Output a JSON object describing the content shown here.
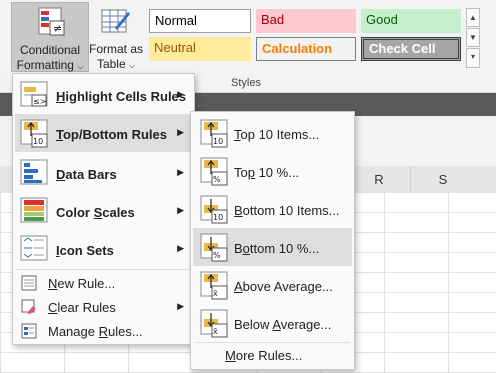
{
  "ribbon": {
    "cond_fmt_line1": "Conditional",
    "cond_fmt_line2": "Formatting",
    "format_table_line1": "Format as",
    "format_table_line2": "Table",
    "group_label": "Styles",
    "styles": [
      {
        "label": "Normal",
        "bg": "#ffffff",
        "fg": "#000000"
      },
      {
        "label": "Bad",
        "bg": "#ffc7ce",
        "fg": "#9c0006"
      },
      {
        "label": "Good",
        "bg": "#c6efce",
        "fg": "#006100"
      },
      {
        "label": "Neutral",
        "bg": "#ffeb9c",
        "fg": "#9c5700"
      },
      {
        "label": "Calculation",
        "bg": "#f2f2f2",
        "fg": "#fa7d00"
      },
      {
        "label": "Check Cell",
        "bg": "#a5a5a5",
        "fg": "#ffffff"
      }
    ]
  },
  "sheet": {
    "columns": [
      "R",
      "S"
    ]
  },
  "menu": {
    "items": [
      {
        "label": "Highlight Cells Rules",
        "hotkey": "H",
        "rest": "ighlight Cells Rules",
        "icon": "highlight-cells-icon"
      },
      {
        "label": "Top/Bottom Rules",
        "hotkey": "T",
        "rest": "op/Bottom Rules",
        "icon": "top-bottom-icon"
      },
      {
        "label": "Data Bars",
        "hotkey": "D",
        "rest": "ata Bars",
        "icon": "data-bars-icon"
      },
      {
        "label": "Color Scales",
        "pre": "Color ",
        "hotkey": "S",
        "rest": "cales",
        "icon": "color-scales-icon"
      },
      {
        "label": "Icon Sets",
        "hotkey": "I",
        "rest": "con Sets",
        "icon": "icon-sets-icon"
      },
      {
        "label": "New Rule...",
        "hotkey": "N",
        "rest": "ew Rule...",
        "icon": "new-rule-icon"
      },
      {
        "label": "Clear Rules",
        "hotkey": "C",
        "rest": "lear Rules",
        "icon": "clear-rules-icon"
      },
      {
        "label": "Manage Rules...",
        "pre": "Manage ",
        "hotkey": "R",
        "rest": "ules...",
        "icon": "manage-rules-icon"
      }
    ]
  },
  "submenu": {
    "items": [
      {
        "pre": "",
        "hotkey": "T",
        "rest": "op 10 Items...",
        "badge": "10",
        "dir": "up"
      },
      {
        "pre": "To",
        "hotkey": "p",
        "rest": " 10 %...",
        "badge": "%",
        "dir": "up"
      },
      {
        "pre": "",
        "hotkey": "B",
        "rest": "ottom 10 Items...",
        "badge": "10",
        "dir": "down"
      },
      {
        "pre": "B",
        "hotkey": "o",
        "rest": "ttom 10 %...",
        "badge": "%",
        "dir": "down"
      },
      {
        "pre": "",
        "hotkey": "A",
        "rest": "bove Average...",
        "badge": "x̄",
        "dir": "up"
      },
      {
        "pre": "Below ",
        "hotkey": "A",
        "rest": "verage...",
        "badge": "x̄",
        "dir": "down"
      }
    ],
    "more_pre": "",
    "more_hotkey": "M",
    "more_rest": "ore Rules..."
  }
}
